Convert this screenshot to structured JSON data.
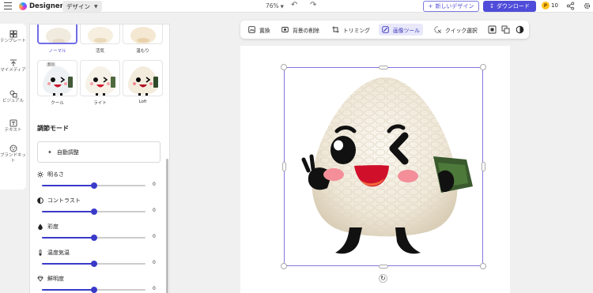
{
  "header": {
    "app_name": "Designer",
    "mode": "デザイン",
    "zoom": "76%",
    "new_design": "新しいデザイン",
    "download": "ダウンロード",
    "credits": "10"
  },
  "rail": {
    "items": [
      {
        "label": "テンプレート",
        "icon": "template-icon"
      },
      {
        "label": "マイメディア",
        "icon": "upload-icon"
      },
      {
        "label": "ビジュアル",
        "icon": "visual-icon"
      },
      {
        "label": "テキスト",
        "icon": "text-icon"
      },
      {
        "label": "ブランドキット",
        "icon": "brand-kit-icon"
      }
    ]
  },
  "filters": {
    "row1": [
      {
        "label": "ノーマル",
        "selected": true
      },
      {
        "label": "活気"
      },
      {
        "label": "温もり"
      }
    ],
    "row2": [
      {
        "label": "クール",
        "tag": "無効"
      },
      {
        "label": "ライト"
      },
      {
        "label": "Lofi"
      }
    ]
  },
  "adjust": {
    "title": "調節モード",
    "auto_label": "自動調整",
    "items": [
      {
        "label": "明るさ",
        "value": "0",
        "level": 0.5,
        "icon": "brightness-icon"
      },
      {
        "label": "コントラスト",
        "value": "0",
        "level": 0.5,
        "icon": "contrast-icon"
      },
      {
        "label": "彩度",
        "value": "0",
        "level": 0.5,
        "icon": "saturation-icon"
      },
      {
        "label": "温度気温",
        "value": "0",
        "level": 0.5,
        "icon": "temperature-icon"
      },
      {
        "label": "鮮明度",
        "value": "0",
        "level": 0.5,
        "icon": "sharpness-icon"
      }
    ]
  },
  "toolbar": {
    "replace": "置換",
    "remove_bg": "背景の削除",
    "crop": "トリミング",
    "image_tools": "画像ツール",
    "quick_select": "クイック選択"
  },
  "colors": {
    "accent": "#4f4cd9",
    "selection": "#8a73e0",
    "slider": "#3a3ac9",
    "coin": "#ffc21a"
  }
}
